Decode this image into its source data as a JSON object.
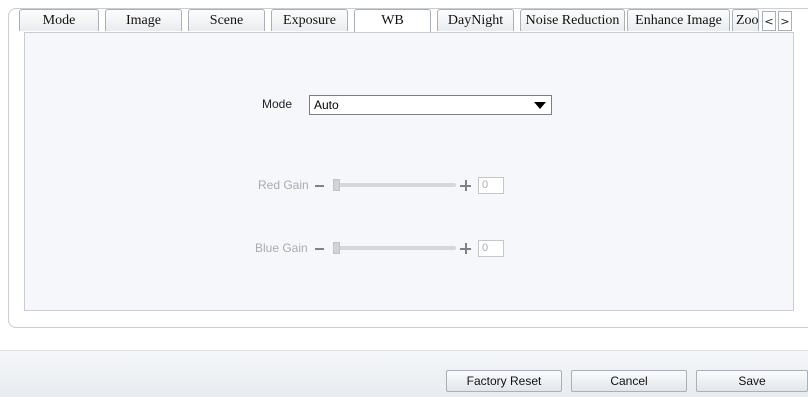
{
  "tabs": [
    {
      "label": "Mode"
    },
    {
      "label": "Image"
    },
    {
      "label": "Scene"
    },
    {
      "label": "Exposure"
    },
    {
      "label": "WB"
    },
    {
      "label": "DayNight"
    },
    {
      "label": "Noise Reduction"
    },
    {
      "label": "Enhance Image"
    },
    {
      "label": "Zoom"
    }
  ],
  "active_tab": "WB",
  "nav": {
    "prev": "<",
    "next": ">"
  },
  "wb": {
    "mode_label": "Mode",
    "mode_value": "Auto",
    "red_gain": {
      "label": "Red Gain",
      "value": "0"
    },
    "blue_gain": {
      "label": "Blue Gain",
      "value": "0"
    }
  },
  "buttons": {
    "factory_reset": "Factory Reset",
    "cancel": "Cancel",
    "save": "Save"
  }
}
